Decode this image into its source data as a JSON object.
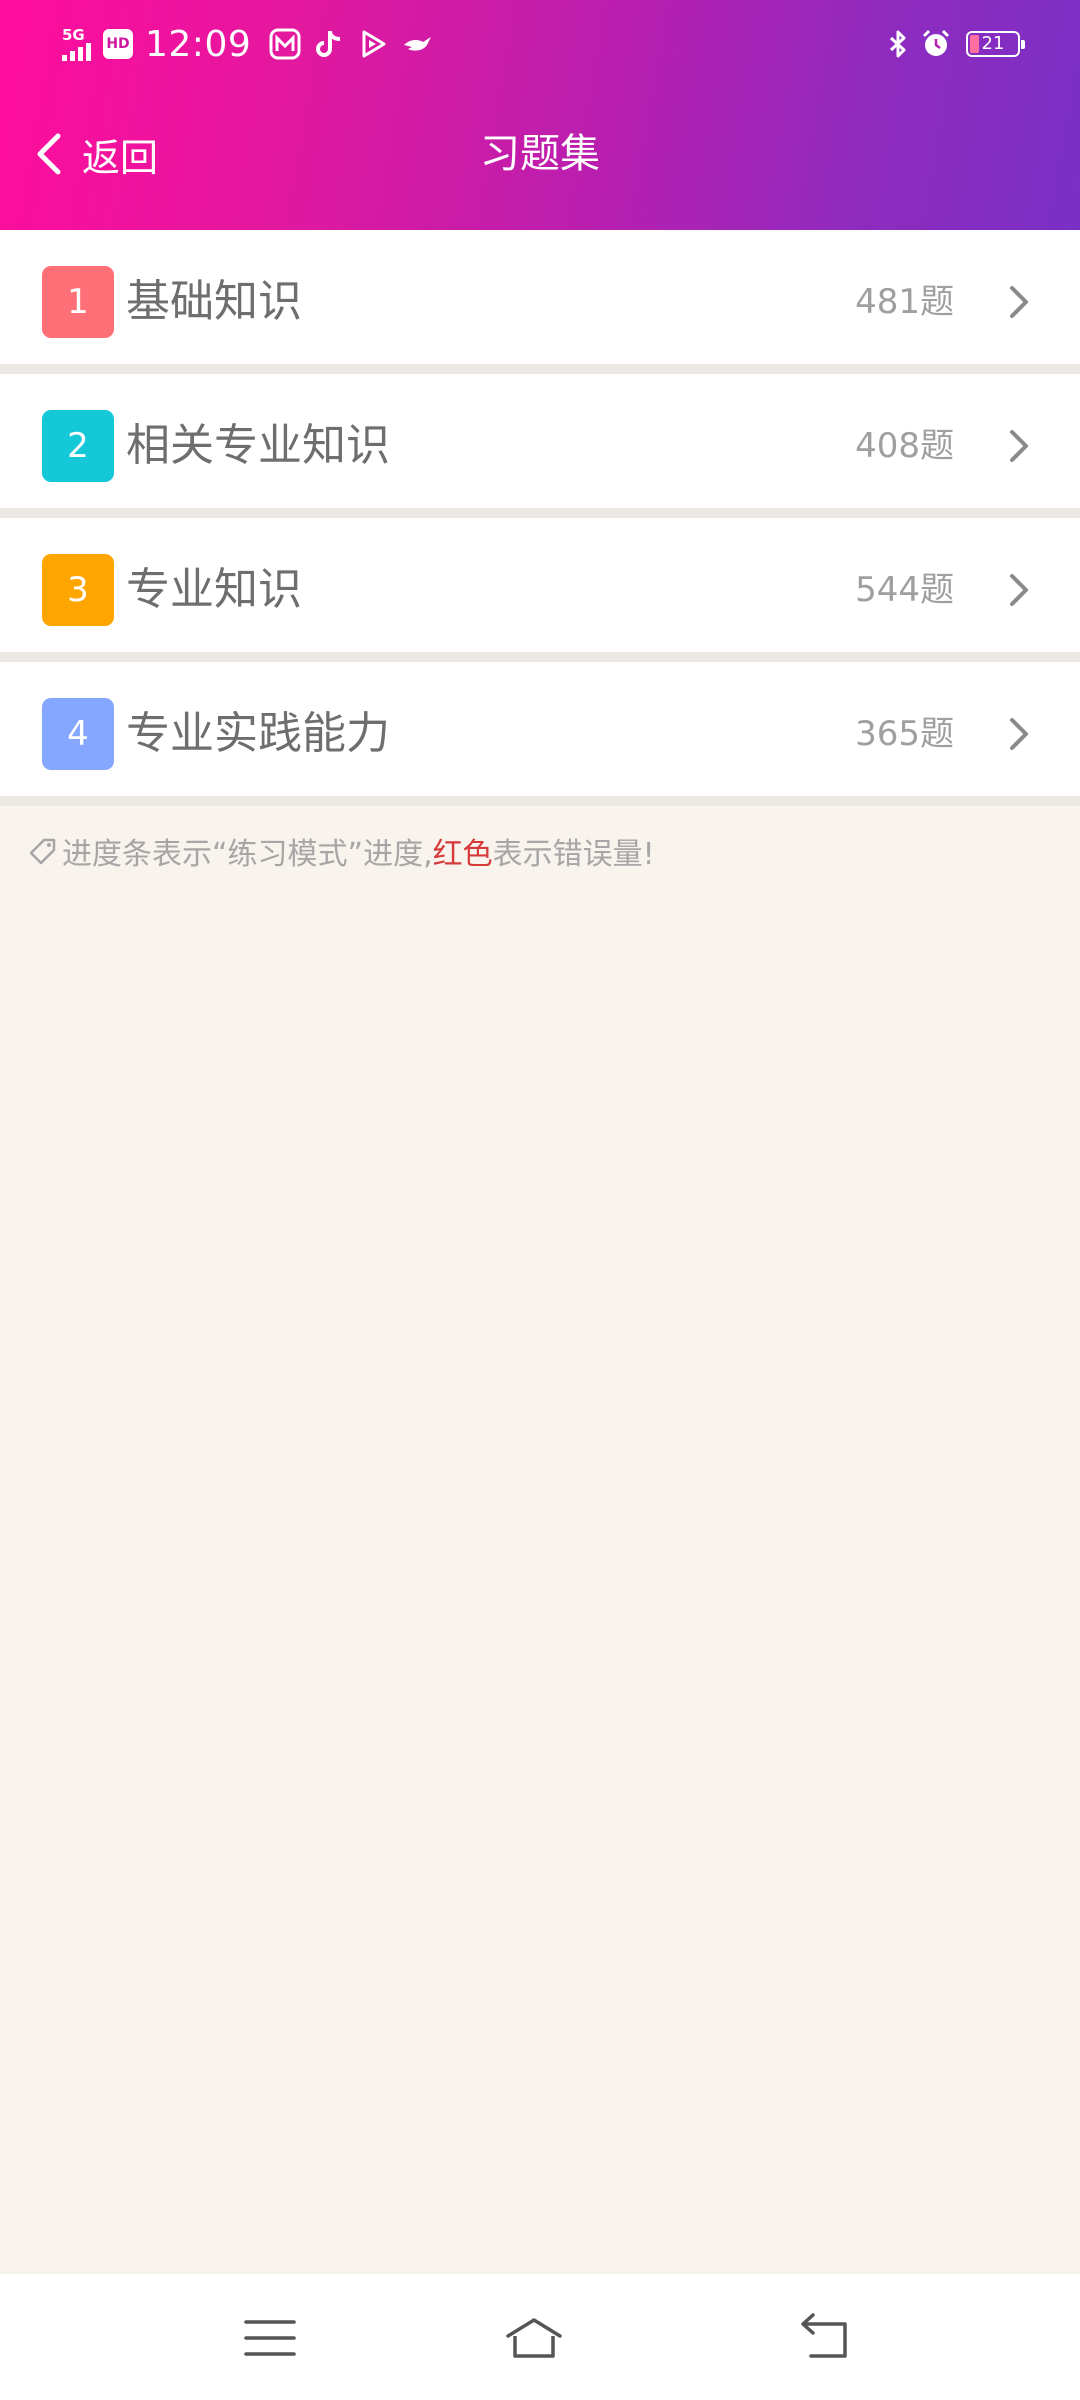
{
  "status_bar": {
    "network": "5G",
    "hd": "HD",
    "time": "12:09",
    "battery_level": "21",
    "icons": [
      "m-app-icon",
      "tiktok-icon",
      "play-icon",
      "bird-icon",
      "bluetooth-icon",
      "alarm-icon"
    ]
  },
  "header": {
    "back_label": "返回",
    "title": "习题集",
    "gradient": [
      "#ff0c9c",
      "#7a2fc4"
    ]
  },
  "items": [
    {
      "index": "1",
      "name": "基础知识",
      "count": "481题",
      "color": "#ff6f78"
    },
    {
      "index": "2",
      "name": "相关专业知识",
      "count": "408题",
      "color": "#15c8d8"
    },
    {
      "index": "3",
      "name": "专业知识",
      "count": "544题",
      "color": "#ffa500"
    },
    {
      "index": "4",
      "name": "专业实践能力",
      "count": "365题",
      "color": "#86a7ff"
    }
  ],
  "tip": {
    "before": "进度条表示“练习模式”进度,",
    "highlight": "红色",
    "after": "表示错误量!"
  },
  "bottom_nav": {
    "icons": [
      "menu-icon",
      "home-icon",
      "back-icon"
    ]
  }
}
